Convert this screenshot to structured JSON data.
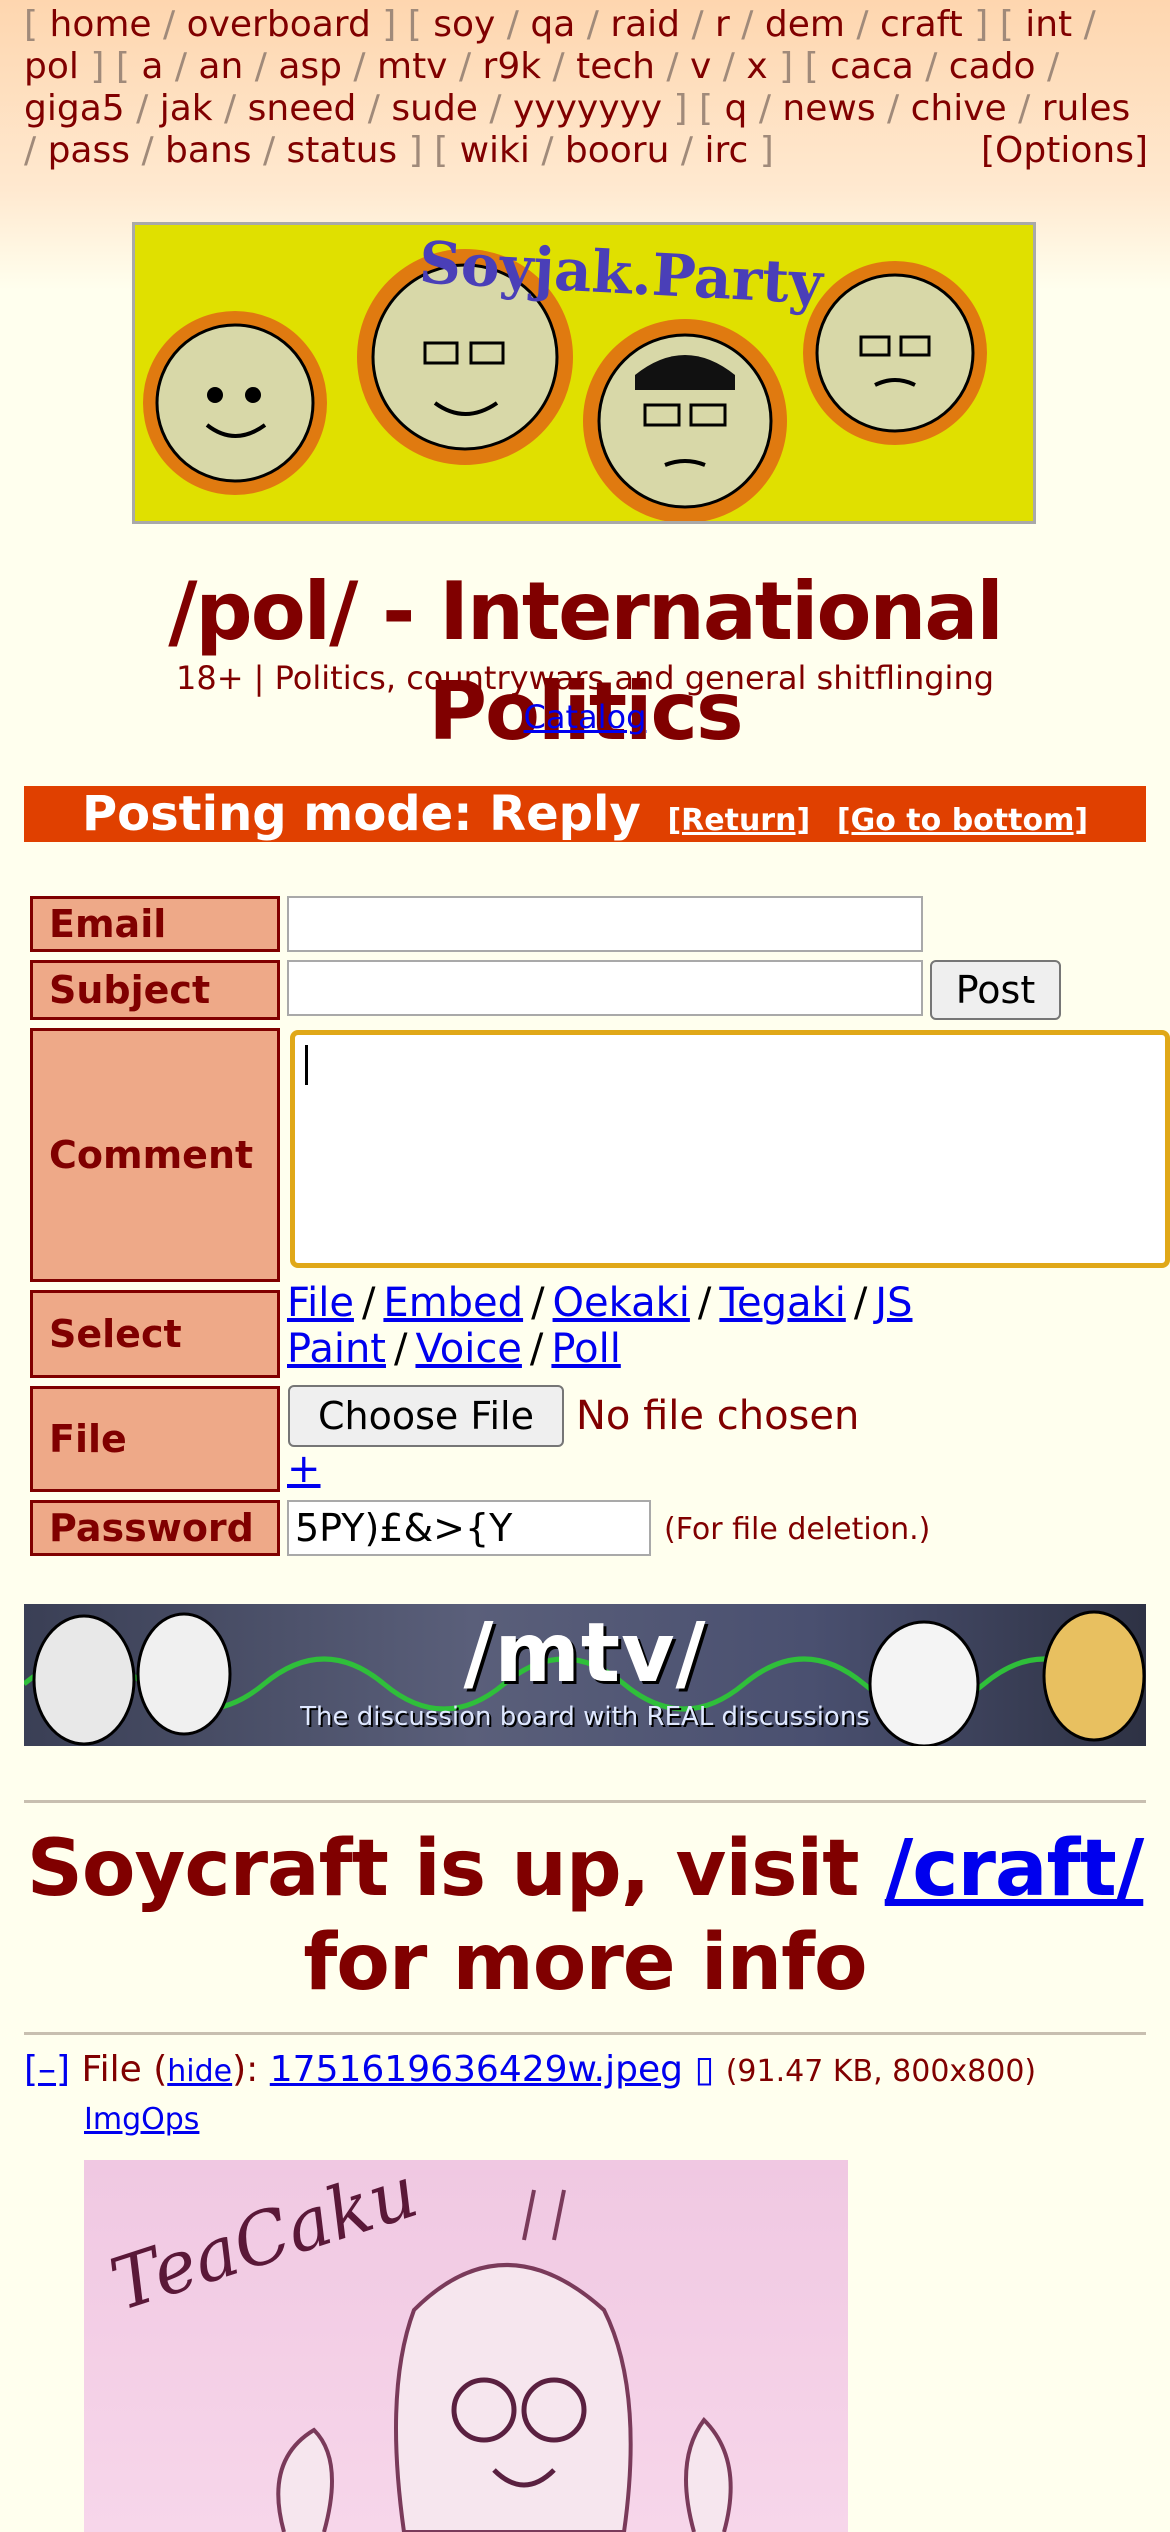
{
  "nav": {
    "groups": [
      [
        "home",
        "overboard"
      ],
      [
        "soy",
        "qa",
        "raid",
        "r",
        "dem",
        "craft"
      ],
      [
        "int",
        "pol"
      ],
      [
        "a",
        "an",
        "asp",
        "mtv",
        "r9k",
        "tech",
        "v",
        "x"
      ],
      [
        "caca",
        "cado",
        "giga5",
        "jak",
        "sneed",
        "sude",
        "yyyyyyy"
      ],
      [
        "q",
        "news",
        "chive",
        "rules",
        "pass",
        "bans",
        "status"
      ],
      [
        "wiki",
        "booru",
        "irc"
      ]
    ],
    "options": "[Options]"
  },
  "banner": {
    "logo_text": "Soyjak.Party"
  },
  "board": {
    "title": "/pol/ - International Politics",
    "subtitle": "18+ | Politics, countrywars and general shitflinging",
    "catalog": "Catalog"
  },
  "posting_mode": {
    "text": "Posting mode: Reply",
    "return": "[Return]",
    "bottom": "[Go to bottom]"
  },
  "form": {
    "email_label": "Email",
    "subject_label": "Subject",
    "post_button": "Post",
    "comment_label": "Comment",
    "select_label": "Select",
    "select_options": [
      "File",
      "Embed",
      "Oekaki",
      "Tegaki",
      "JS Paint",
      "Voice",
      "Poll"
    ],
    "file_label": "File",
    "choose_file": "Choose File",
    "no_file": "No file chosen",
    "plus": "+",
    "password_label": "Password",
    "password_value": "5PY)£&>{Y",
    "password_note": "(For file deletion.)"
  },
  "mtv_banner": {
    "title": "/mtv/",
    "tagline": "The discussion board with REAL discussions"
  },
  "announcement": {
    "text_before": "Soycraft is up, visit ",
    "link": "/craft/",
    "text_after": "for more info"
  },
  "post": {
    "collapse": "[–]",
    "file_prefix": "File (",
    "hide": "hide",
    "file_mid": "):",
    "filename": "1751619636429w.jpeg",
    "meta": "(91.47 KB, 800x800)",
    "imgops": "ImgOps",
    "image_signature": "TeaCaku"
  },
  "colors": {
    "accent": "#800000",
    "posting_mode_bg": "#e04000",
    "label_bg": "#eea988",
    "banner_bg": "#e0e000",
    "link": "#0000ee"
  }
}
